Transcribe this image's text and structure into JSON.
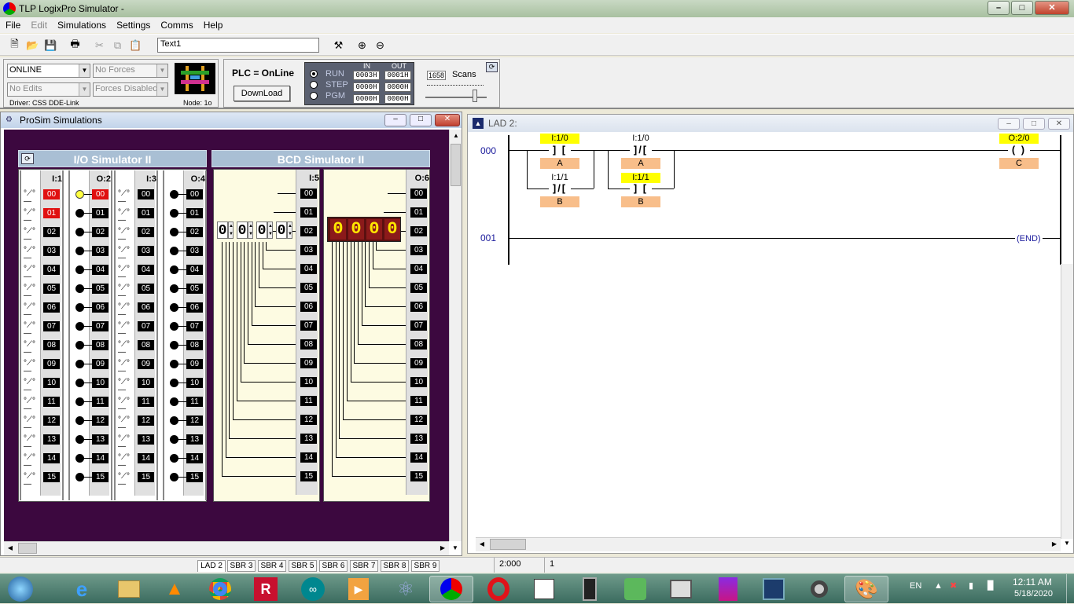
{
  "window": {
    "title": "TLP LogixPro Simulator  -"
  },
  "menu": [
    "File",
    "Edit",
    "Simulations",
    "Settings",
    "Comms",
    "Help"
  ],
  "toolbar": {
    "text_field": "Text1"
  },
  "control": {
    "mode": "ONLINE",
    "forces": "No Forces",
    "edits": "No Edits",
    "forces_state": "Forces Disabled",
    "driver": "Driver: CSS DDE-Link",
    "node": "Node: 1o",
    "plc_status": "PLC = OnLine",
    "download": "DownLoad",
    "run": "RUN",
    "step": "STEP",
    "pgm": "PGM",
    "in_label": "IN",
    "out_label": "OUT",
    "in_values": [
      "0003H",
      "0000H",
      "0000H"
    ],
    "out_values": [
      "0001H",
      "0000H",
      "0000H"
    ],
    "scan_count": "1658",
    "scans_label": "Scans"
  },
  "prosim": {
    "title": "ProSim Simulations",
    "io_title": "I/O Simulator II",
    "bcd_title": "BCD Simulator II",
    "modules": [
      {
        "label": "I:1",
        "on_bits": [
          "00",
          "01"
        ]
      },
      {
        "label": "O:2",
        "on_bits": [
          "00"
        ]
      },
      {
        "label": "I:3",
        "on_bits": []
      },
      {
        "label": "O:4",
        "on_bits": []
      }
    ],
    "bcd_in": "I:5",
    "bcd_out": "O:6",
    "bcd_in_digits": [
      "0",
      "0",
      "0",
      "0"
    ],
    "bcd_out_digits": [
      "0",
      "0",
      "0",
      "0"
    ],
    "bits": [
      "00",
      "01",
      "02",
      "03",
      "04",
      "05",
      "06",
      "07",
      "08",
      "09",
      "10",
      "11",
      "12",
      "13",
      "14",
      "15"
    ]
  },
  "lad": {
    "title": "LAD 2:",
    "rung0": "000",
    "rung1": "001",
    "c1_addr": "I:1/0",
    "c1_desc": "A",
    "c2_addr": "I:1/1",
    "c2_desc": "B",
    "c3_addr": "I:1/0",
    "c3_desc": "A",
    "c4_addr": "I:1/1",
    "c4_desc": "B",
    "coil_addr": "O:2/0",
    "coil_desc": "C",
    "end_label": "END"
  },
  "status": {
    "tabs": [
      "LAD 2",
      "SBR 3",
      "SBR 4",
      "SBR 5",
      "SBR 6",
      "SBR 7",
      "SBR 8",
      "SBR 9"
    ],
    "position": "2:000",
    "rung": "1"
  },
  "taskbar": {
    "lang": "EN",
    "time": "12:11 AM",
    "date": "5/18/2020"
  },
  "colors": {
    "sim_bg": "#3c083f",
    "bit_on": "#e01010",
    "lamp_on": "#ffff40",
    "ladder_highlight": "#ffff00",
    "desc_bg": "#f8be8a"
  }
}
